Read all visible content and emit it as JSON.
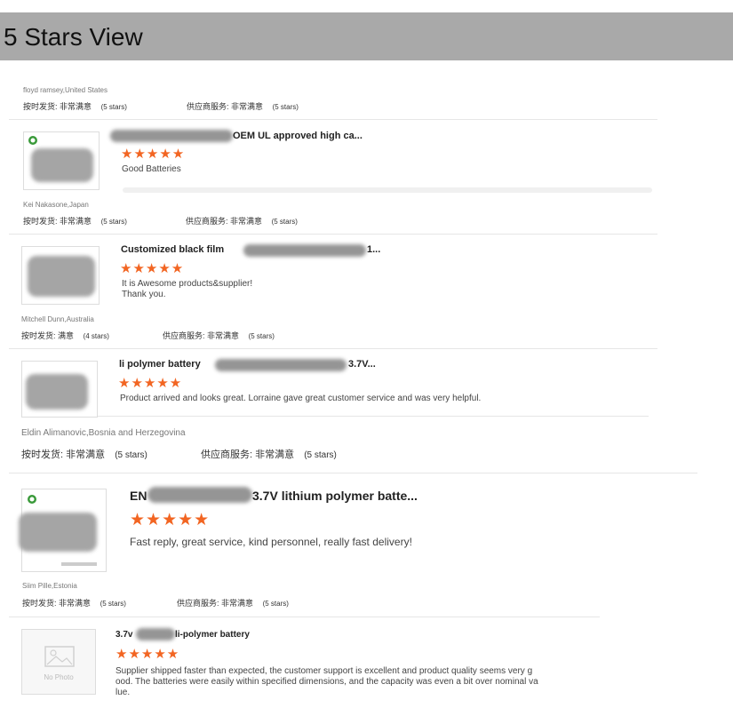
{
  "page": {
    "title": "5 Stars View"
  },
  "reviews": [
    {
      "reviewer": "floyd ramsey,United States",
      "delivery_label": "按时发货:",
      "delivery_value": "非常满意",
      "delivery_stars": "(5 stars)",
      "service_label": "供应商服务:",
      "service_value": "非常满意",
      "service_stars": "(5 stars)"
    },
    {
      "product_title": "OEM UL approved high ca...",
      "rating": 5,
      "stars": "★★★★★",
      "comment": "Good Batteries",
      "reviewer": "Kei Nakasone,Japan",
      "delivery_label": "按时发货:",
      "delivery_value": "非常满意",
      "delivery_stars": "(5 stars)",
      "service_label": "供应商服务:",
      "service_value": "非常满意",
      "service_stars": "(5 stars)"
    },
    {
      "product_title_start": "Customized black film",
      "product_title_end": "1...",
      "rating": 5,
      "stars": "★★★★★",
      "comment_line1": "It is Awesome products&supplier!",
      "comment_line2": "Thank you.",
      "reviewer": "Mitchell Dunn,Australia",
      "delivery_label": "按时发货:",
      "delivery_value": "满意",
      "delivery_stars": "(4 stars)",
      "service_label": "供应商服务:",
      "service_value": "非常满意",
      "service_stars": "(5 stars)"
    },
    {
      "product_title_start": "li polymer battery",
      "product_title_end": "3.7V...",
      "rating": 5,
      "stars": "★★★★★",
      "comment": "Product arrived and looks great. Lorraine gave great customer service and was very helpful.",
      "reviewer": "Eldin Alimanovic,Bosnia and Herzegovina",
      "delivery_label": "按时发货:",
      "delivery_value": "非常满意",
      "delivery_stars": "(5 stars)",
      "service_label": "供应商服务:",
      "service_value": "非常满意",
      "service_stars": "(5 stars)"
    },
    {
      "product_title_start": "EN",
      "product_title_end": "3.7V lithium polymer batte...",
      "rating": 5,
      "stars": "★★★★★",
      "comment": "Fast reply, great service, kind personnel, really fast delivery!",
      "reviewer": "Siim Pille,Estonia",
      "delivery_label": "按时发货:",
      "delivery_value": "非常满意",
      "delivery_stars": "(5 stars)",
      "service_label": "供应商服务:",
      "service_value": "非常满意",
      "service_stars": "(5 stars)"
    },
    {
      "product_title_start": "3.7v",
      "product_title_end": "li-polymer battery",
      "rating": 5,
      "stars": "★★★★★",
      "no_photo_label": "No Photo",
      "comment_line1": "Supplier shipped faster than expected, the customer support is excellent and product quality seems very g",
      "comment_line2": "ood. The batteries were easily within specified dimensions, and the capacity was even a bit over nominal va",
      "comment_line3": "lue."
    }
  ],
  "colors": {
    "header_bg": "#a9a9a9",
    "star": "#f26522"
  }
}
